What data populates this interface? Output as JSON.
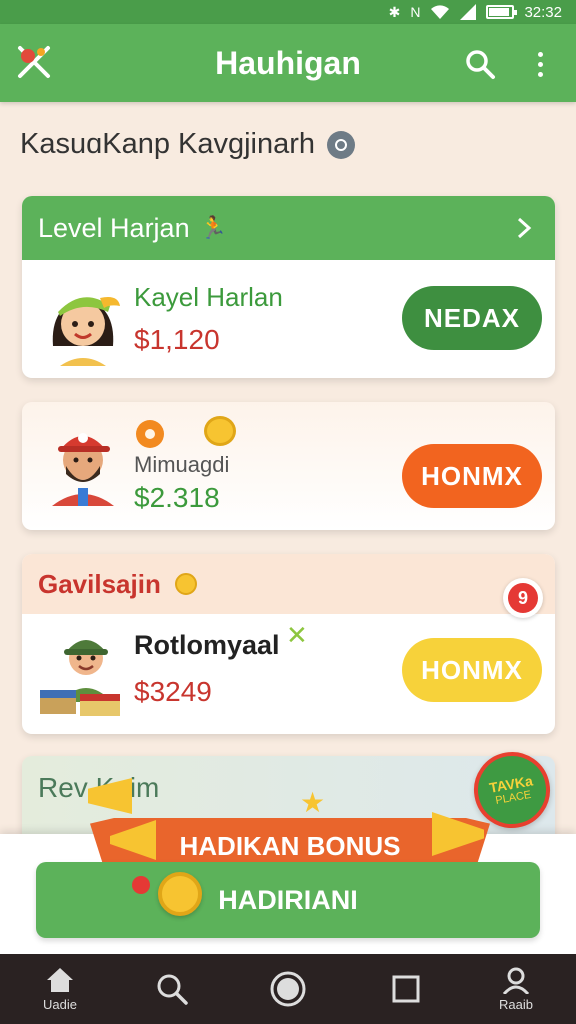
{
  "status": {
    "time": "32:32",
    "battery_level": 0.9
  },
  "app": {
    "title": "Hauhigan"
  },
  "section": {
    "title": "KasuɑKanp Kavgjinarh"
  },
  "cards": [
    {
      "header": "Level Harjan",
      "name": "Kayel Harlan",
      "price": "$1,120",
      "button": "NEDAX"
    },
    {
      "name": "Mimuagdi",
      "price": "$2.318",
      "button": "HONMX"
    },
    {
      "header": "Gavilsajin",
      "badge": "9",
      "name": "Rotlomyaal",
      "price": "$3249",
      "button": "HONMX"
    },
    {
      "header": "Rev Kaim",
      "sticker_line1": "TAVKa",
      "sticker_line2": "PLACE"
    }
  ],
  "bonus": {
    "ribbon": "HADIKAN BONUS",
    "button": "HADIRIANI"
  },
  "nav": [
    {
      "label": "Uadie",
      "icon": "home-icon"
    },
    {
      "label": "",
      "icon": "search-icon"
    },
    {
      "label": "",
      "icon": "circle-icon"
    },
    {
      "label": "",
      "icon": "square-icon"
    },
    {
      "label": "Raaib",
      "icon": "profile-icon"
    }
  ],
  "colors": {
    "green": "#5cb25a",
    "dark_green": "#3e8f40",
    "orange": "#f2641f",
    "yellow": "#f7d23a",
    "price_red": "#c8352e",
    "price_green": "#3c9a3c"
  }
}
